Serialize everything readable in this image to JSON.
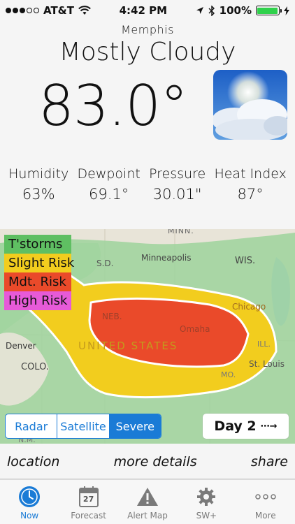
{
  "status_bar": {
    "carrier": "AT&T",
    "time": "4:42 PM",
    "battery": "100%"
  },
  "current": {
    "city": "Memphis",
    "condition": "Mostly Cloudy",
    "temperature": "83.0°"
  },
  "stats": [
    {
      "label": "Humidity",
      "value": "63%"
    },
    {
      "label": "Dewpoint",
      "value": "69.1°"
    },
    {
      "label": "Pressure",
      "value": "30.01\""
    },
    {
      "label": "Heat Index",
      "value": "87°"
    }
  ],
  "legend": [
    {
      "label": "T'storms",
      "color": "#5fbf62"
    },
    {
      "label": "Slight Risk",
      "color": "#f2cd1e"
    },
    {
      "label": "Mdt. Risk",
      "color": "#ea4a2a"
    },
    {
      "label": "High Risk",
      "color": "#e75ad8"
    }
  ],
  "map_labels": {
    "minn": "MINN.",
    "sd": "S.D.",
    "minneapolis": "Minneapolis",
    "wis": "WIS.",
    "neb": "NEB.",
    "omaha": "Omaha",
    "chicago": "Chicago",
    "denver": "Denver",
    "united_states": "UNITED STATES",
    "colo": "COLO.",
    "st_louis": "St. Louis",
    "mo": "MO.",
    "ill": "ILL.",
    "nm": "N.M."
  },
  "map_controls": {
    "radar": "Radar",
    "satellite": "Satellite",
    "severe": "Severe",
    "day": "Day 2",
    "day_arrow": "⋯→"
  },
  "actions": {
    "location": "location",
    "details": "more details",
    "share": "share"
  },
  "tabs": [
    {
      "label": "Now",
      "icon": "clock-icon",
      "active": true
    },
    {
      "label": "Forecast",
      "icon": "calendar-icon",
      "calendar_day": "27"
    },
    {
      "label": "Alert Map",
      "icon": "warning-icon"
    },
    {
      "label": "SW+",
      "icon": "gear-icon"
    },
    {
      "label": "More",
      "icon": "more-icon"
    }
  ],
  "colors": {
    "accent": "#1a7bd6",
    "battery": "#2fd14b"
  }
}
